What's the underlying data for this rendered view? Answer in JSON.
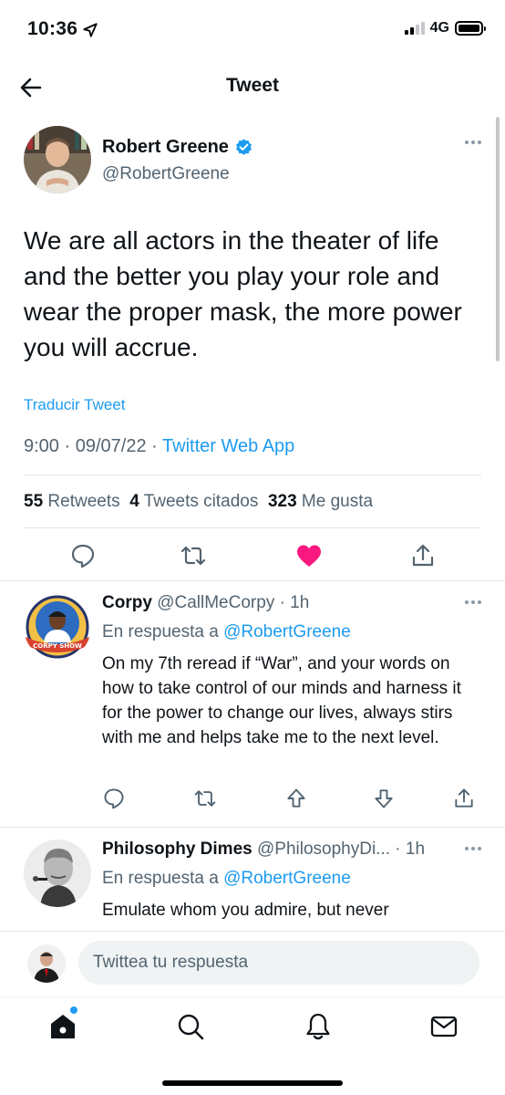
{
  "status_bar": {
    "time": "10:36",
    "network": "4G"
  },
  "header": {
    "title": "Tweet"
  },
  "tweet": {
    "author_name": "Robert Greene",
    "author_handle": "@RobertGreene",
    "text": "We are all actors in the theater of life and the better you play your role and wear the proper mask, the more power you will accrue.",
    "translate_label": "Traducir Tweet",
    "time": "9:00",
    "date": "09/07/22",
    "separator": "·",
    "source": "Twitter Web App",
    "retweets_count": "55",
    "retweets_label": "Retweets",
    "quotes_count": "4",
    "quotes_label": "Tweets citados",
    "likes_count": "323",
    "likes_label": "Me gusta",
    "liked": true,
    "like_color": "#f91880"
  },
  "replies": [
    {
      "name": "Corpy",
      "handle": "@CallMeCorpy",
      "time": "· 1h",
      "reply_prefix": "En respuesta a",
      "reply_to": "@RobertGreene",
      "text": "On my 7th reread if “War”, and your words on how to take control of our minds and harness it for the power to change our lives, always stirs with me and helps take me to the next level.",
      "avatar_text": "CORPY SHOW"
    },
    {
      "name": "Philosophy Dimes",
      "handle": "@PhilosophyDi...",
      "time": "· 1h",
      "reply_prefix": "En respuesta a",
      "reply_to": "@RobertGreene",
      "text": "Emulate whom you admire, but never"
    }
  ],
  "compose": {
    "placeholder": "Twittea tu respuesta"
  },
  "tabs": [
    "home-icon",
    "search-icon",
    "notifications-icon",
    "messages-icon"
  ],
  "colors": {
    "accent": "#1d9bf0",
    "secondary_text": "#536471",
    "like": "#f91880"
  }
}
